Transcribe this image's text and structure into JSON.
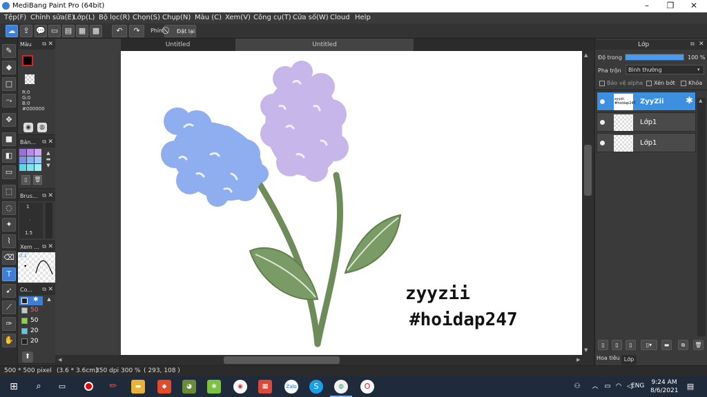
{
  "window": {
    "title": "MediBang Paint Pro (64bit)",
    "minimize": "–",
    "maximize": "❐",
    "close": "✕"
  },
  "menu": [
    "Tệp(F)",
    "Chỉnh sửa(E)",
    "Lớp(L)",
    "Bộ lọc(R)",
    "Chọn(S)",
    "Chụp(N)",
    "Màu (C)",
    "Xem(V)",
    "Công cụ(T)",
    "Cửa số(W)",
    "Cloud",
    "Help"
  ],
  "toolbar": {
    "shortcut_label": "Phím",
    "reset_label": "Đặt lại"
  },
  "panels": {
    "color": {
      "title": "Màu",
      "r": "R:0",
      "g": "G:0",
      "b": "B:0",
      "hex": "#000000",
      "primary": "#000000",
      "secondary": "#ffffff"
    },
    "palette": {
      "title": "Bản...",
      "swatches": [
        "#9b6fe0",
        "#b88af0",
        "#c9a8f5",
        "#7b8fe8",
        "#8fb0f0",
        "#a0c8f8",
        "#5bd6e8",
        "#7ee3f0",
        "#9cf0f5"
      ]
    },
    "brush": {
      "title": "Brus...",
      "size_top": "1",
      "size_bottom": "1.5"
    },
    "navigator": {
      "title": "Xem ...",
      "zoom": "0.1"
    },
    "brushcolor": {
      "title": "Co...",
      "rows": [
        {
          "swatch": "#c8c8c8",
          "value": "50",
          "value_color": "#ff6a6a"
        },
        {
          "swatch": "#8fd14f",
          "value": "50",
          "value_color": "#ffffff"
        },
        {
          "swatch": "#4fd0e8",
          "value": "20",
          "value_color": "#ffffff"
        },
        {
          "swatch": "#222222",
          "value": "20",
          "value_color": "#ffffff"
        }
      ]
    }
  },
  "tabs": [
    "Untitled",
    "Untitled"
  ],
  "canvas": {
    "signature_line1": "zyyzii",
    "signature_line2": "#hoidap247"
  },
  "layers_panel": {
    "title": "Lớp",
    "opacity_label": "Độ trong",
    "opacity_value": "100 %",
    "opacity_fraction": 1.0,
    "blend_label": "Pha trộn",
    "blend_value": "Bình thường",
    "protect_alpha": "Bảo vệ alpha",
    "clipping": "Xén bớt",
    "lock": "Khóa",
    "layers": [
      {
        "name": "ZyyZii",
        "selected": true,
        "thumb_text": "zyyzii #hoidap247"
      },
      {
        "name": "Lớp1",
        "selected": false
      },
      {
        "name": "Lớp1",
        "selected": false
      }
    ],
    "bottom_tabs": [
      "Hoa tiêu",
      "Lớp"
    ]
  },
  "status": {
    "size": "500 * 500 pixel",
    "cm": "(3.6 * 3.6cm)",
    "dpi": "350 dpi",
    "zoom": "300 %",
    "coords": "( 293, 108 )"
  },
  "taskbar": {
    "time": "9:24 AM",
    "date": "8/6/2021",
    "lang": "ENG",
    "zalo_label": "Zalo"
  }
}
